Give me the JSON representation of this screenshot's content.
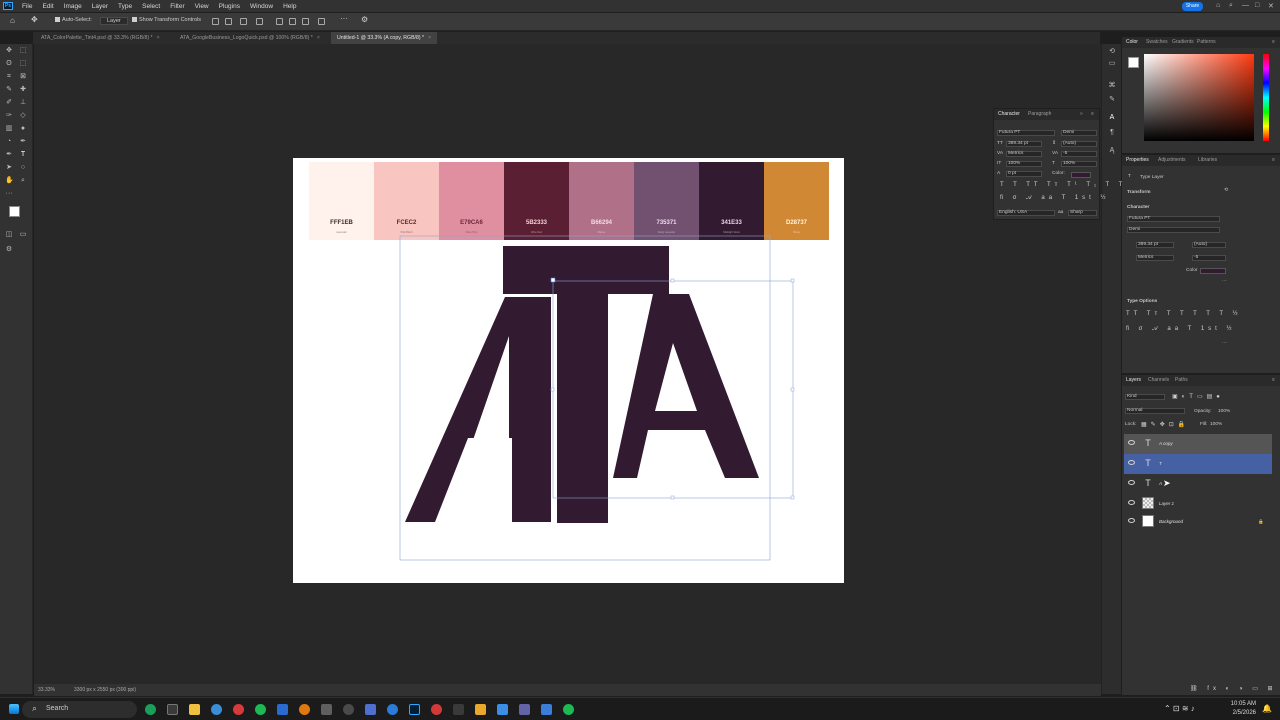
{
  "menu": {
    "app_logo": "Ps",
    "items": [
      "File",
      "Edit",
      "Image",
      "Layer",
      "Type",
      "Select",
      "Filter",
      "View",
      "Plugins",
      "Window",
      "Help"
    ],
    "share_label": "Share"
  },
  "options_bar": {
    "auto_select_label": "Auto-Select:",
    "auto_select_target": "Layer",
    "show_transform_label": "Show Transform Controls"
  },
  "tabs": [
    {
      "label": "ATA_ColorPalette_Tint4.psd @ 33.3% (RGB/8) *",
      "active": false
    },
    {
      "label": "ATA_GoogleBusiness_LogoQuick.psd @ 100% (RGB/8) *",
      "active": false
    },
    {
      "label": "Untitled-1 @ 33.3% (A copy, RGB/8) *",
      "active": true
    }
  ],
  "palette": [
    {
      "hex": "FFF1EB",
      "color": "#fff1eb",
      "text": "#3a2a2a",
      "sub": "Lavender"
    },
    {
      "hex": "FCEC2",
      "color": "#f9c5c0",
      "text": "#5a2a2a",
      "sub": "Pink Blush"
    },
    {
      "hex": "E79CA6",
      "color": "#e08fa0",
      "text": "#6b2a3a",
      "sub": "Rose Pink"
    },
    {
      "hex": "5B2333",
      "color": "#5b1f33",
      "text": "#f2d0d6",
      "sub": "Wine Red"
    },
    {
      "hex": "B66294",
      "color": "#b07088",
      "text": "#f2dbe4",
      "sub": "Mauve"
    },
    {
      "hex": "735371",
      "color": "#725070",
      "text": "#eedcea",
      "sub": "Dusty Lavender"
    },
    {
      "hex": "341E33",
      "color": "#321a30",
      "text": "#e9d7e6",
      "sub": "Midnight Violet"
    },
    {
      "hex": "D28737",
      "color": "#d18835",
      "text": "#fff2df",
      "sub": "Honey"
    }
  ],
  "logo": {
    "color": "#321a30"
  },
  "status": {
    "zoom": "33.33%",
    "doc_info": "3300 px x 2550 px (300 ppi)"
  },
  "color_panel": {
    "tabs": [
      "Color",
      "Swatches",
      "Gradients",
      "Patterns"
    ]
  },
  "character_panel": {
    "tabs": [
      "Character",
      "Paragraph"
    ],
    "font_family": "Futura PT",
    "font_style": "Demi",
    "font_size": "389.34 pt",
    "leading": "(Auto)",
    "kerning": "Metrics",
    "tracking": "-5",
    "vertical_scale": "100%",
    "horizontal_scale": "100%",
    "baseline": "0 pt",
    "color_label": "Color:",
    "language": "English: USA",
    "antialias": "Sharp"
  },
  "properties_panel": {
    "tabs": [
      "Properties",
      "Adjustments",
      "Libraries"
    ],
    "layer_type": "Type Layer",
    "transform_label": "Transform",
    "character_label": "Character",
    "font_family": "Futura PT",
    "font_style": "Demi",
    "font_size": "389.34 pt",
    "leading": "(Auto)",
    "kerning": "Metrics",
    "tracking": "-5",
    "color_label": "Color",
    "type_options_label": "Type Options"
  },
  "layers_panel": {
    "tabs": [
      "Layers",
      "Channels",
      "Paths"
    ],
    "filter_kind": "Kind",
    "blend_mode": "Normal",
    "opacity_label": "Opacity:",
    "opacity": "100%",
    "lock_label": "Lock:",
    "fill_label": "Fill:",
    "fill": "100%",
    "layers": [
      {
        "name": "A copy",
        "type": "text",
        "state": "hover"
      },
      {
        "name": "T",
        "type": "text",
        "state": "selected"
      },
      {
        "name": "A",
        "type": "text",
        "state": "normal"
      },
      {
        "name": "Layer 1",
        "type": "pixel",
        "state": "normal"
      },
      {
        "name": "Background",
        "type": "background",
        "state": "normal"
      }
    ]
  },
  "taskbar": {
    "search_label": "Search",
    "time": "10:05 AM",
    "date": "2/5/2026"
  }
}
